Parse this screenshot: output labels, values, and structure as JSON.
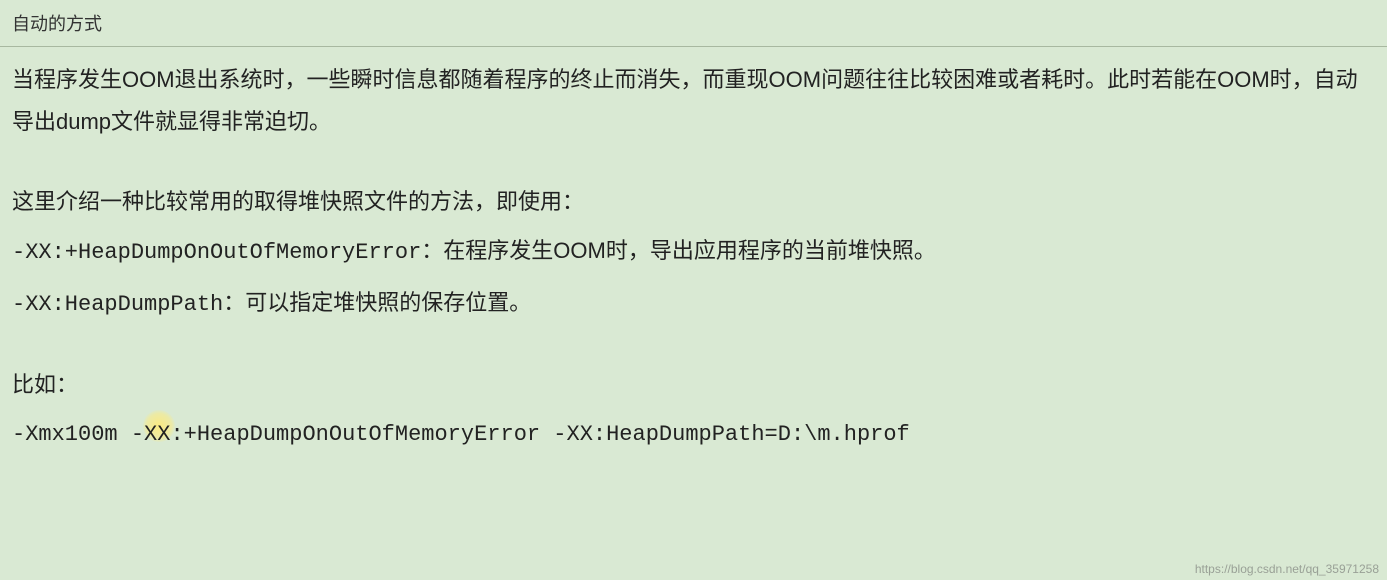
{
  "header": {
    "title": "自动的方式"
  },
  "body": {
    "para1": "当程序发生OOM退出系统时，一些瞬时信息都随着程序的终止而消失，而重现OOM问题往往比较困难或者耗时。此时若能在OOM时，自动导出dump文件就显得非常迫切。",
    "intro": "这里介绍一种比较常用的取得堆快照文件的方法，即使用：",
    "opt1_flag": "-XX:+HeapDumpOnOutOfMemoryError：",
    "opt1_desc": "在程序发生OOM时，导出应用程序的当前堆快照。",
    "opt2_flag": "-XX:HeapDumpPath：",
    "opt2_desc": "可以指定堆快照的保存位置。",
    "example_label": "比如：",
    "example_cmd_pre": "-Xmx100m  -X",
    "example_cmd_cursor": "X",
    "example_cmd_post": ":+HeapDumpOnOutOfMemoryError  -XX:HeapDumpPath=D:\\m.hprof"
  },
  "watermark": "https://blog.csdn.net/qq_35971258"
}
